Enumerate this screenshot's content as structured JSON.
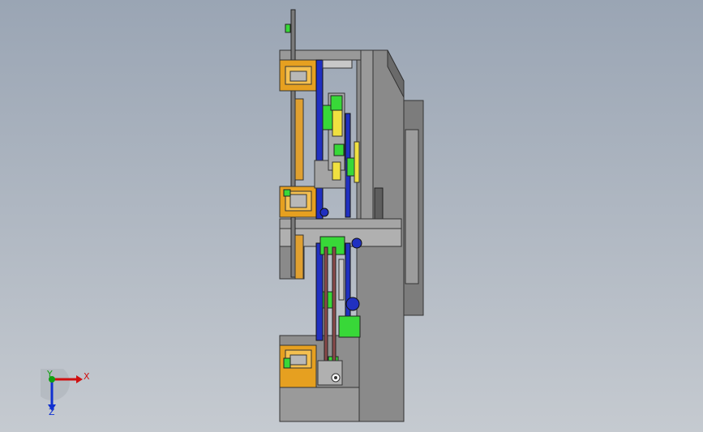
{
  "viewport": {
    "background_top": "#9aa5b4",
    "background_bottom": "#c5cad0"
  },
  "model": {
    "part_colors": {
      "frame": "#8e8e8e",
      "frame_dark": "#6f6f6f",
      "orange_block": "#e6a020",
      "green_part": "#38d838",
      "blue_rail": "#2030c0",
      "yellow_part": "#f0e040"
    }
  },
  "triad": {
    "x_label": "X",
    "y_label": "Y",
    "z_label": "Z",
    "x_color": "#d01010",
    "y_color": "#10a010",
    "z_color": "#1030d0"
  }
}
